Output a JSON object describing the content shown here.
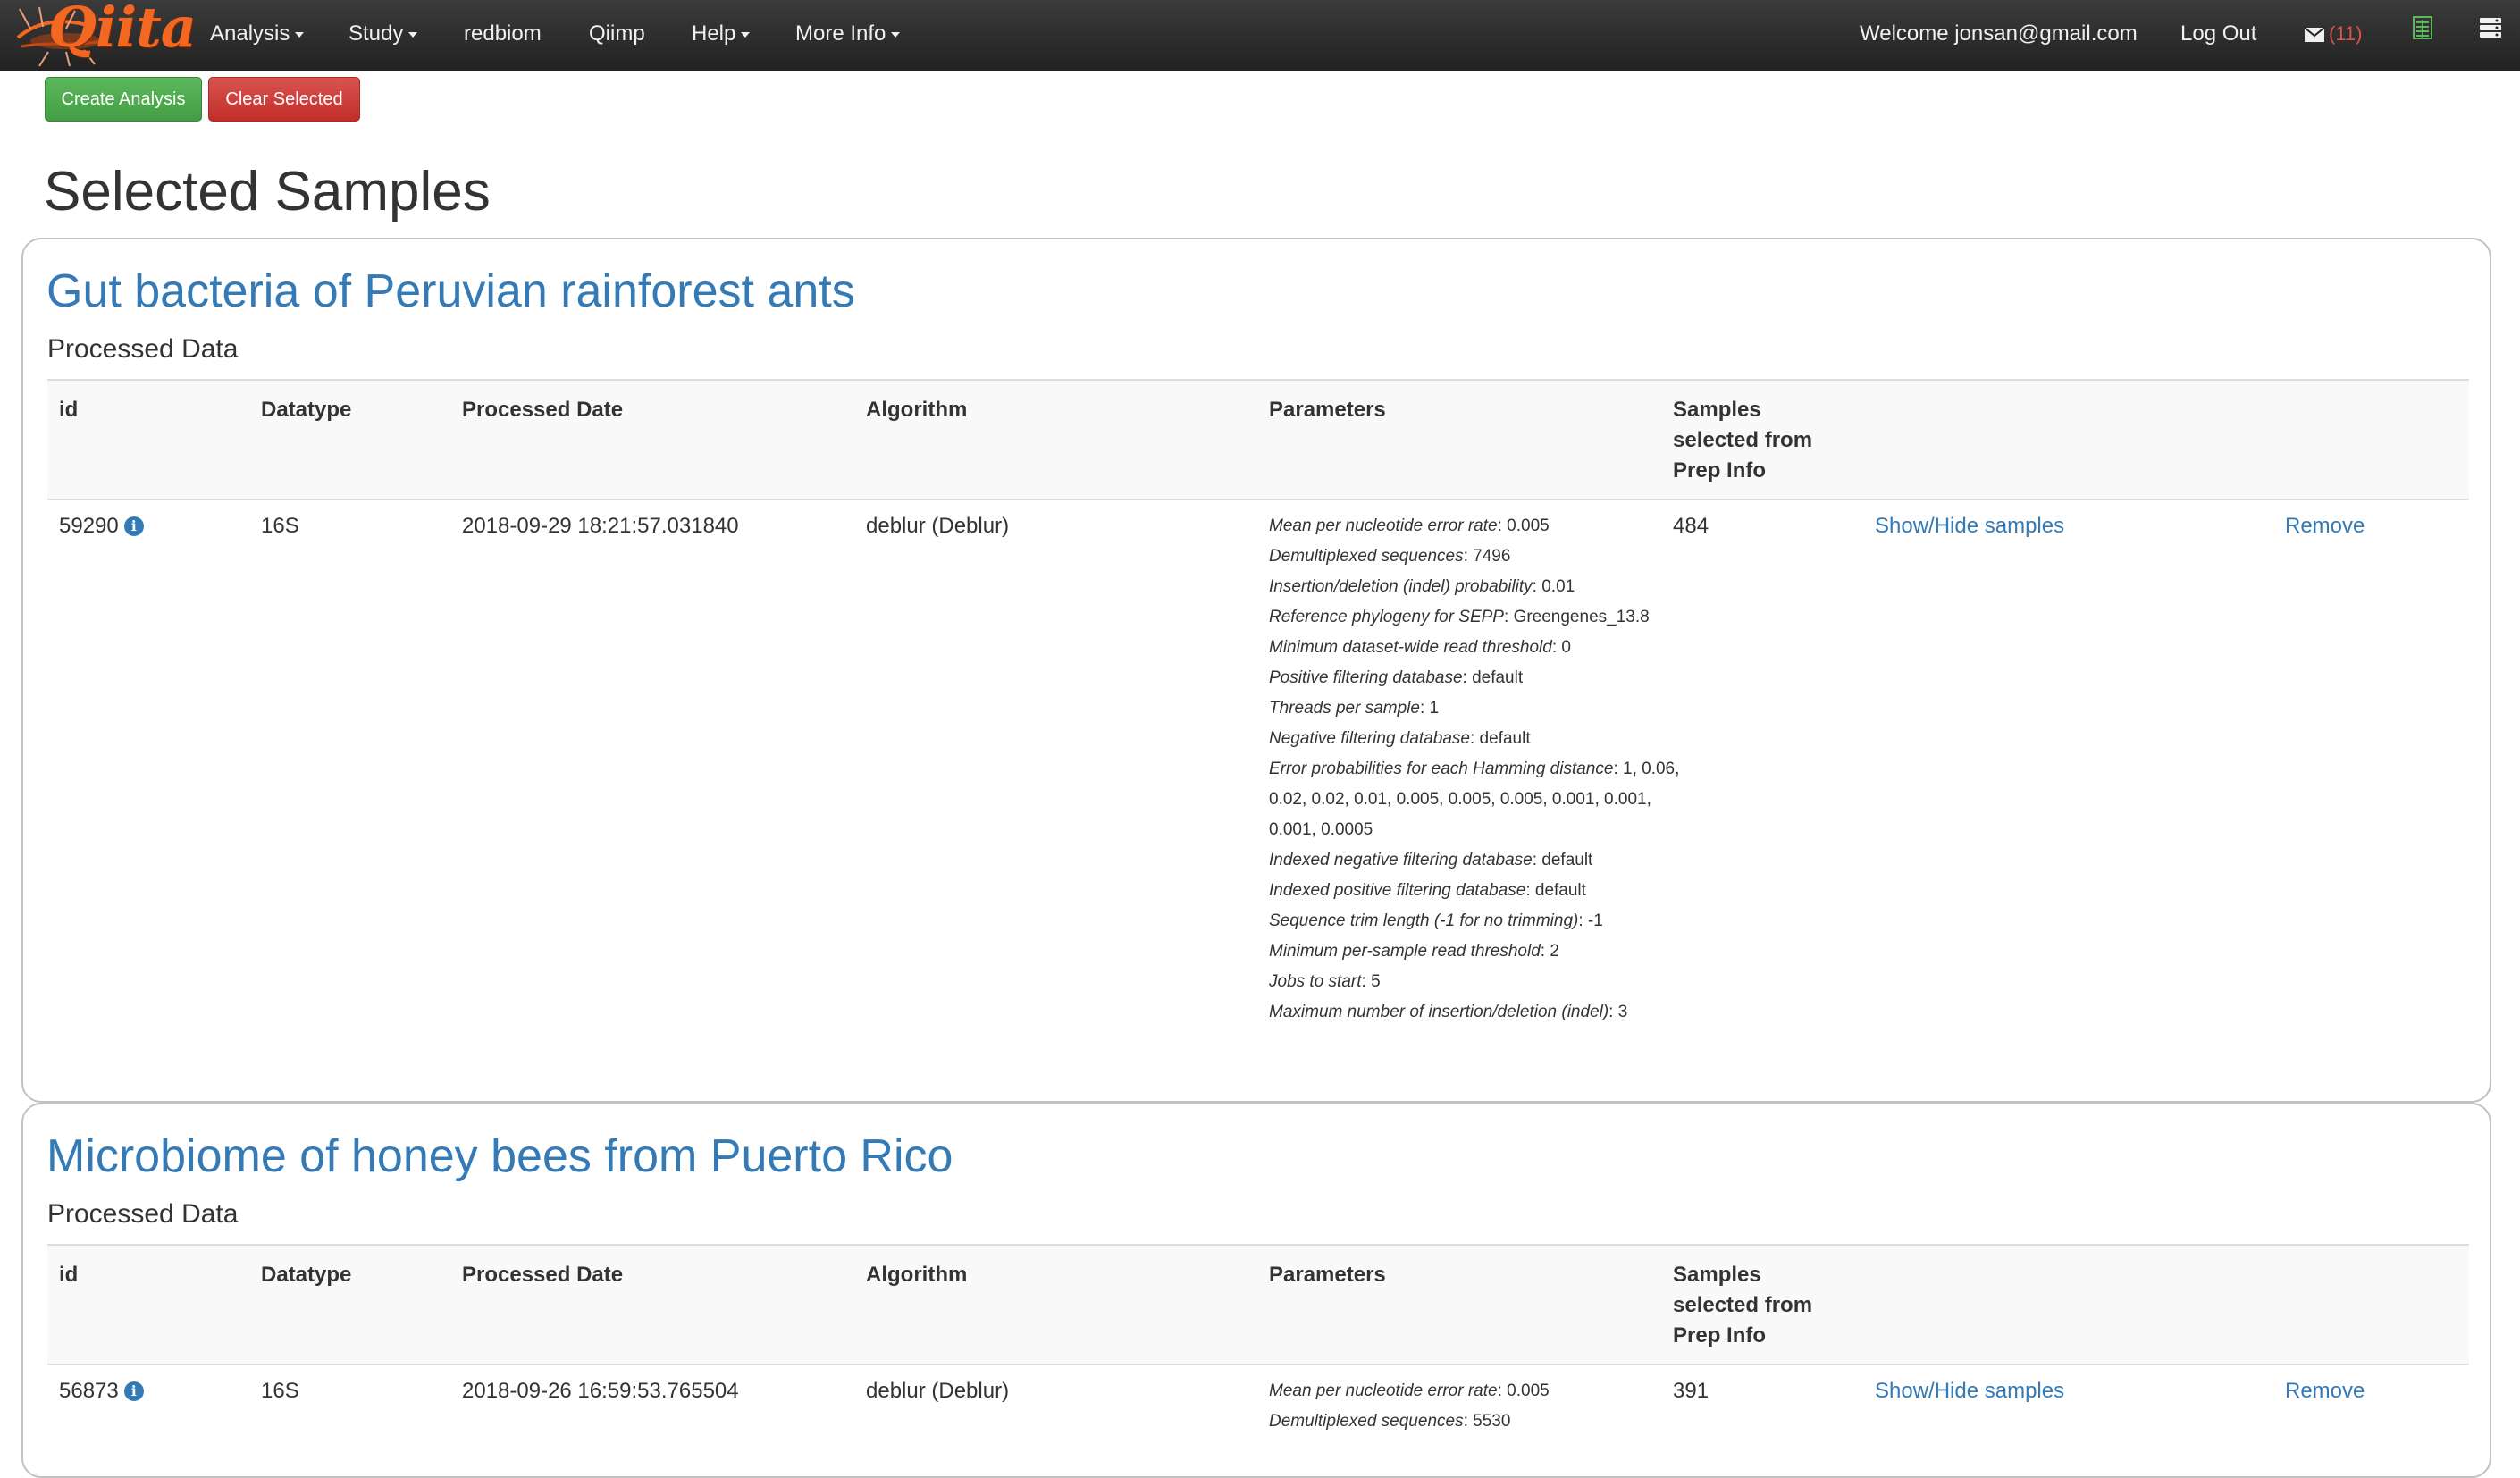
{
  "navbar": {
    "logo_text": "Qiita",
    "menus": [
      {
        "label": "Analysis",
        "dropdown": true
      },
      {
        "label": "Study",
        "dropdown": true
      },
      {
        "label": "redbiom",
        "dropdown": false
      },
      {
        "label": "Qiimp",
        "dropdown": false
      },
      {
        "label": "Help",
        "dropdown": true
      },
      {
        "label": "More Info",
        "dropdown": true
      }
    ],
    "welcome": "Welcome jonsan@gmail.com",
    "logout": "Log Out",
    "message_count": "(11)",
    "icons": [
      "envelope-icon",
      "spreadsheet-icon",
      "menu-icon"
    ]
  },
  "actions": {
    "create_analysis": "Create Analysis",
    "clear_selected": "Clear Selected"
  },
  "page_title": "Selected Samples",
  "columns": {
    "id": "id",
    "datatype": "Datatype",
    "processed_date": "Processed Date",
    "algorithm": "Algorithm",
    "parameters": "Parameters",
    "samples": "Samples selected from Prep Info"
  },
  "studies": [
    {
      "title": "Gut bacteria of Peruvian rainforest ants",
      "processed_heading": "Processed Data",
      "row": {
        "id": "59290",
        "datatype": "16S",
        "processed_date": "2018-09-29 18:21:57.031840",
        "algorithm": "deblur (Deblur)",
        "samples": "484",
        "show_hide": "Show/Hide samples",
        "remove": "Remove",
        "params": [
          {
            "k": "Mean per nucleotide error rate",
            "v": "0.005"
          },
          {
            "k": "Demultiplexed sequences",
            "v": "7496"
          },
          {
            "k": "Insertion/deletion (indel) probability",
            "v": "0.01"
          },
          {
            "k": "Reference phylogeny for SEPP",
            "v": "Greengenes_13.8"
          },
          {
            "k": "Minimum dataset-wide read threshold",
            "v": "0"
          },
          {
            "k": "Positive filtering database",
            "v": "default"
          },
          {
            "k": "Threads per sample",
            "v": "1"
          },
          {
            "k": "Negative filtering database",
            "v": "default"
          },
          {
            "k": "Error probabilities for each Hamming distance",
            "v": "1, 0.06, 0.02, 0.02, 0.01, 0.005, 0.005, 0.005, 0.001, 0.001, 0.001, 0.0005"
          },
          {
            "k": "Indexed negative filtering database",
            "v": "default"
          },
          {
            "k": "Indexed positive filtering database",
            "v": "default"
          },
          {
            "k": "Sequence trim length (-1 for no trimming)",
            "v": "-1"
          },
          {
            "k": "Minimum per-sample read threshold",
            "v": "2"
          },
          {
            "k": "Jobs to start",
            "v": "5"
          },
          {
            "k": "Maximum number of insertion/deletion (indel)",
            "v": "3"
          }
        ]
      }
    },
    {
      "title": "Microbiome of honey bees from Puerto Rico",
      "processed_heading": "Processed Data",
      "row": {
        "id": "56873",
        "datatype": "16S",
        "processed_date": "2018-09-26 16:59:53.765504",
        "algorithm": "deblur (Deblur)",
        "samples": "391",
        "show_hide": "Show/Hide samples",
        "remove": "Remove",
        "params": [
          {
            "k": "Mean per nucleotide error rate",
            "v": "0.005"
          },
          {
            "k": "Demultiplexed sequences",
            "v": "5530"
          }
        ]
      }
    }
  ],
  "colors": {
    "navbar": "#222222",
    "link": "#337ab7",
    "logo": "#f26722",
    "success": "#5cb85c",
    "danger": "#d9534f",
    "badge": "#d9534f",
    "sheet_icon": "#5cb85c"
  }
}
